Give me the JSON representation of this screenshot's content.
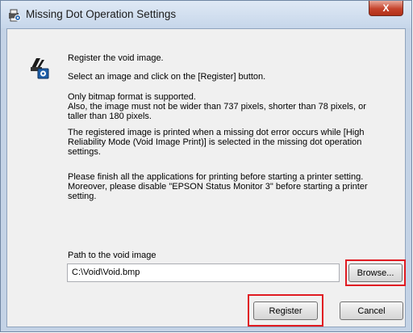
{
  "window": {
    "title": "Missing Dot Operation Settings",
    "close_glyph": "X"
  },
  "content": {
    "heading": "Register the void image.",
    "instruction": "Select an image and click on the [Register] button.",
    "format_lines": [
      "Only bitmap format is supported.",
      "Also, the image must not be wider than 737 pixels, shorter than 78 pixels, or",
      "taller than 180 pixels."
    ],
    "printed_lines": [
      "The registered image is printed when a missing dot error occurs while [High",
      "Reliability Mode (Void Image Print)] is selected in the missing dot operation",
      "settings."
    ],
    "finish_lines": [
      "Please finish all the applications for printing before starting a printer setting.",
      "Moreover, please disable \"EPSON Status Monitor 3\" before starting a printer",
      "setting."
    ]
  },
  "path": {
    "label": "Path to the void image",
    "value": "C:\\Void\\Void.bmp"
  },
  "buttons": {
    "browse": "Browse...",
    "register": "Register",
    "cancel": "Cancel"
  },
  "icons": {
    "title": "printer-gear-icon",
    "content": "printer-settings-icon"
  },
  "colors": {
    "highlight": "#e01b22",
    "title_bar": "#c6d6ea",
    "close_button": "#c5432c"
  }
}
